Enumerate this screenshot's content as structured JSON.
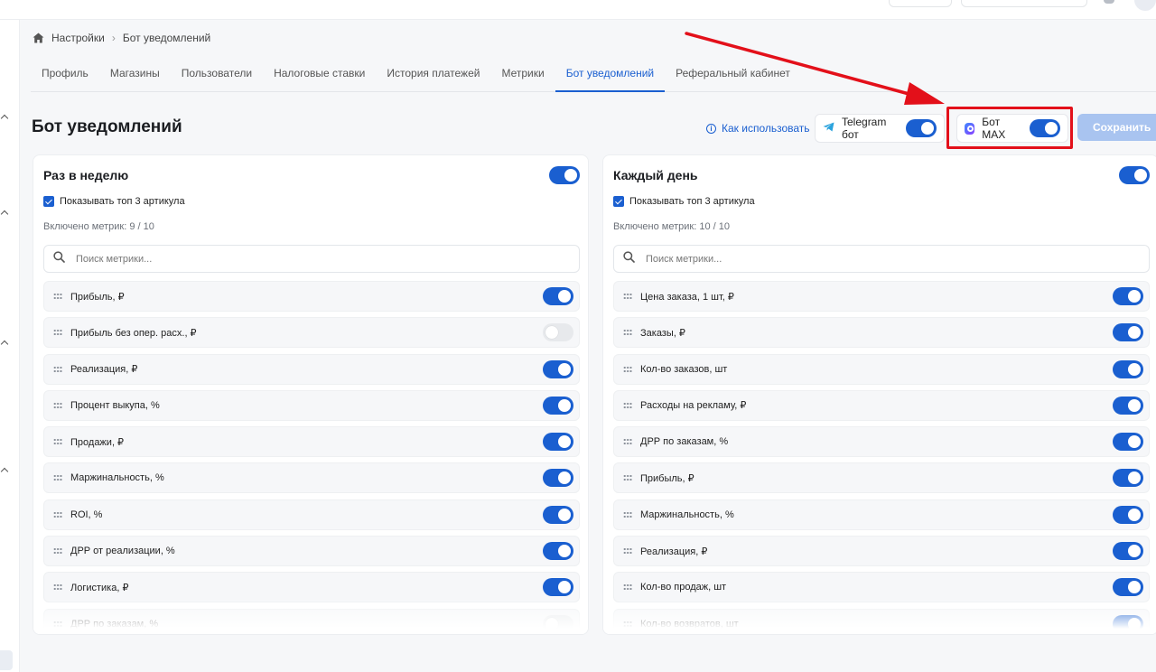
{
  "breadcrumb": {
    "home": "Настройки",
    "current": "Бот уведомлений"
  },
  "tabs": [
    {
      "label": "Профиль"
    },
    {
      "label": "Магазины"
    },
    {
      "label": "Пользователи"
    },
    {
      "label": "Налоговые ставки"
    },
    {
      "label": "История платежей"
    },
    {
      "label": "Метрики"
    },
    {
      "label": "Бот уведомлений",
      "active": true
    },
    {
      "label": "Реферальный кабинет"
    }
  ],
  "page_title": "Бот уведомлений",
  "header": {
    "help_label": "Как использовать",
    "telegram": {
      "label": "Telegram бот",
      "enabled": true
    },
    "max": {
      "label": "Бот MAX",
      "enabled": true
    },
    "save_label": "Сохранить"
  },
  "accent_color": "#1a5fd0",
  "highlight_color": "#e3101a",
  "weekly": {
    "title": "Раз в неделю",
    "enabled": true,
    "top3_label": "Показывать топ 3 артикула",
    "top3_checked": true,
    "metrics_count": "Включено метрик: 9 / 10",
    "search_placeholder": "Поиск метрики...",
    "metrics": [
      {
        "label": "Прибыль, ₽",
        "on": true
      },
      {
        "label": "Прибыль без опер. расх., ₽",
        "on": false
      },
      {
        "label": "Реализация, ₽",
        "on": true
      },
      {
        "label": "Процент выкупа, %",
        "on": true
      },
      {
        "label": "Продажи, ₽",
        "on": true
      },
      {
        "label": "Маржинальность, %",
        "on": true
      },
      {
        "label": "ROI, %",
        "on": true
      },
      {
        "label": "ДРР от реализации, %",
        "on": true
      },
      {
        "label": "Логистика, ₽",
        "on": true
      },
      {
        "label": "ДРР по заказам, %",
        "on": false
      }
    ]
  },
  "daily": {
    "title": "Каждый день",
    "enabled": true,
    "top3_label": "Показывать топ 3 артикула",
    "top3_checked": true,
    "metrics_count": "Включено метрик: 10 / 10",
    "search_placeholder": "Поиск метрики...",
    "metrics": [
      {
        "label": "Цена заказа, 1 шт, ₽",
        "on": true
      },
      {
        "label": "Заказы, ₽",
        "on": true
      },
      {
        "label": "Кол-во заказов, шт",
        "on": true
      },
      {
        "label": "Расходы на рекламу, ₽",
        "on": true
      },
      {
        "label": "ДРР по заказам, %",
        "on": true
      },
      {
        "label": "Прибыль, ₽",
        "on": true
      },
      {
        "label": "Маржинальность, %",
        "on": true
      },
      {
        "label": "Реализация, ₽",
        "on": true
      },
      {
        "label": "Кол-во продаж, шт",
        "on": true
      },
      {
        "label": "Кол-во возвратов, шт",
        "on": true
      }
    ]
  }
}
